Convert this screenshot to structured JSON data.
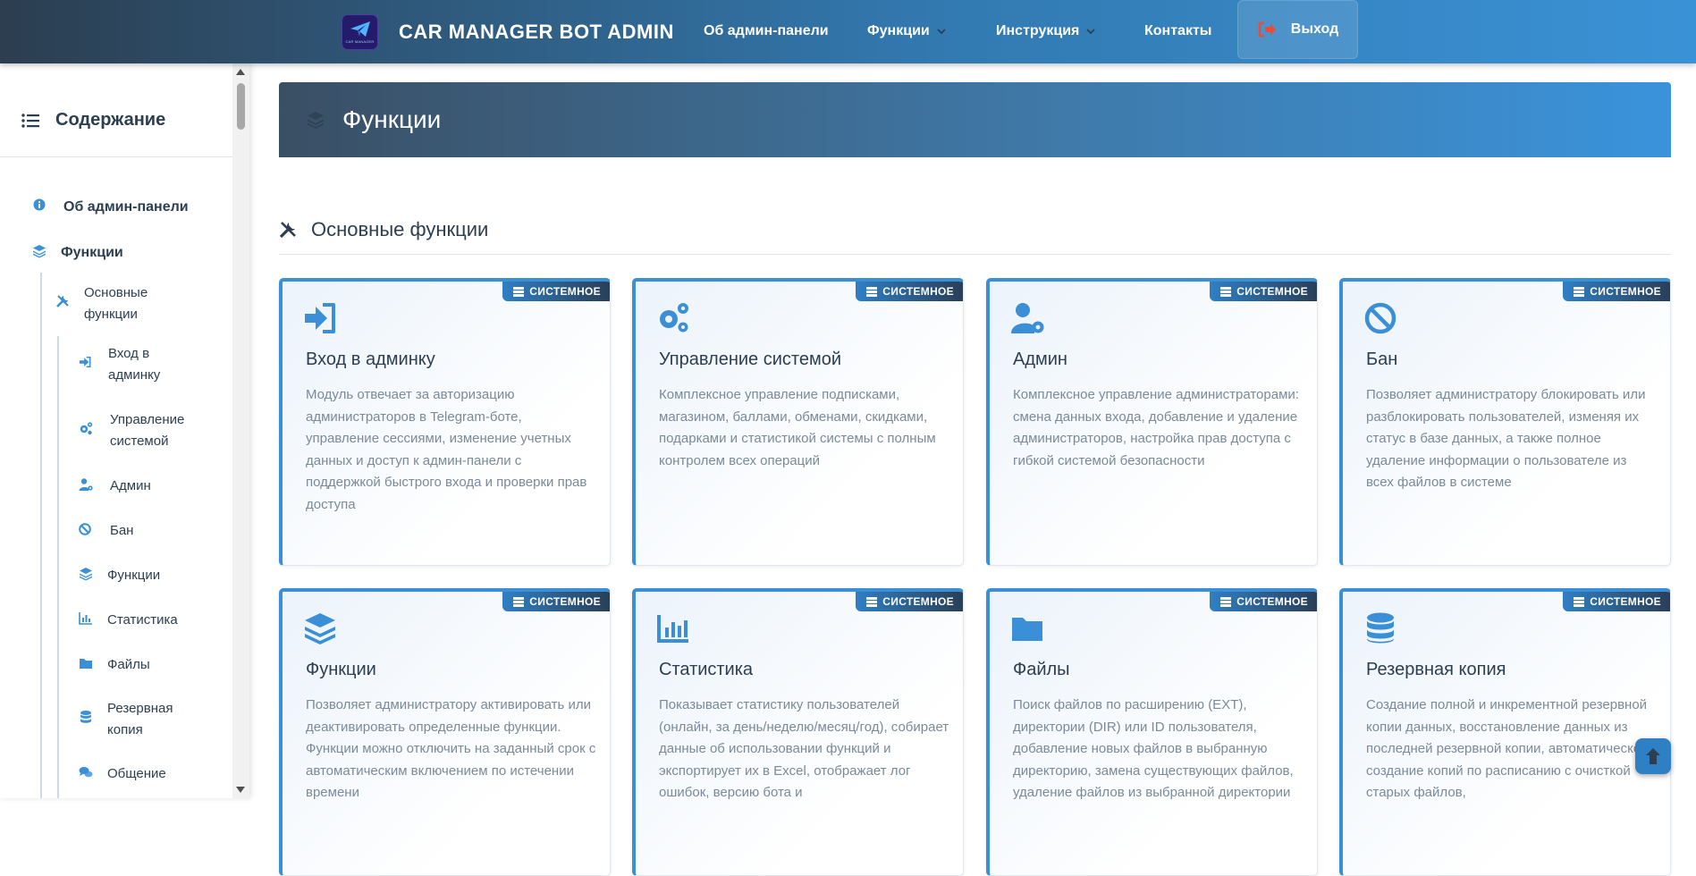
{
  "navbar": {
    "brand_title": "CAR MANAGER BOT ADMIN",
    "logo_text": "CAR MANAGER",
    "links": [
      {
        "label": "Об админ-панели"
      },
      {
        "label": "Функции"
      },
      {
        "label": "Инструкция"
      },
      {
        "label": "Контакты"
      }
    ],
    "logout_label": "Выход"
  },
  "sidebar": {
    "title": "Содержание",
    "items": [
      {
        "label": "Об админ-панели",
        "icon": "info-icon"
      },
      {
        "label": "Функции",
        "icon": "layers-icon"
      },
      {
        "label": "Основные функции",
        "icon": "tools-icon"
      },
      {
        "label": "Вход в админку",
        "icon": "sign-in-icon"
      },
      {
        "label": "Управление системой",
        "icon": "gears-icon"
      },
      {
        "label": "Админ",
        "icon": "user-gear-icon"
      },
      {
        "label": "Бан",
        "icon": "ban-icon"
      },
      {
        "label": "Функции",
        "icon": "layers-icon"
      },
      {
        "label": "Статистика",
        "icon": "chart-icon"
      },
      {
        "label": "Файлы",
        "icon": "folder-icon"
      },
      {
        "label": "Резервная копия",
        "icon": "database-icon"
      },
      {
        "label": "Общение",
        "icon": "comments-icon"
      }
    ]
  },
  "main": {
    "page_title": "Функции",
    "section_title": "Основные функции",
    "badge_label": "СИСТЕМНОЕ",
    "cards": [
      {
        "title": "Вход в админку",
        "icon": "sign-in-icon",
        "description": "Модуль отвечает за авторизацию администраторов в Telegram-боте, управление сессиями, изменение учетных данных и доступ к админ-панели с поддержкой быстрого входа и проверки прав доступа"
      },
      {
        "title": "Управление системой",
        "icon": "gears-icon",
        "description": "Комплексное управление подписками, магазином, баллами, обменами, скидками, подарками и статистикой системы с полным контролем всех операций"
      },
      {
        "title": "Админ",
        "icon": "user-gear-icon",
        "description": "Комплексное управление администраторами: смена данных входа, добавление и удаление администраторов, настройка прав доступа с гибкой системой безопасности"
      },
      {
        "title": "Бан",
        "icon": "ban-icon",
        "description": "Позволяет администратору блокировать или разблокировать пользователей, изменяя их статус в базе данных, а также полное удаление информации о пользователе из всех файлов в системе"
      },
      {
        "title": "Функции",
        "icon": "layers-icon",
        "description": "Позволяет администратору активировать или деактивировать определенные функции. Функции можно отключить на заданный срок с автоматическим включением по истечении времени"
      },
      {
        "title": "Статистика",
        "icon": "chart-icon",
        "description": "Показывает статистику пользователей (онлайн, за день/неделю/месяц/год), собирает данные об использовании функций и экспортирует их в Excel, отображает лог ошибок, версию бота и"
      },
      {
        "title": "Файлы",
        "icon": "folder-icon",
        "description": "Поиск файлов по расширению (EXT), директории (DIR) или ID пользователя, добавление новых файлов в выбранную директорию, замена существующих файлов, удаление файлов из выбранной директории"
      },
      {
        "title": "Резервная копия",
        "icon": "database-icon",
        "description": "Создание полной и инкрементной резервной копии данных, восстановление данных из последней резервной копии, автоматическое создание копий по расписанию с очисткой старых файлов,"
      }
    ]
  },
  "colors": {
    "accent": "#3a8fd6",
    "dark": "#2c3e50",
    "logout_icon": "#e74c3c"
  }
}
